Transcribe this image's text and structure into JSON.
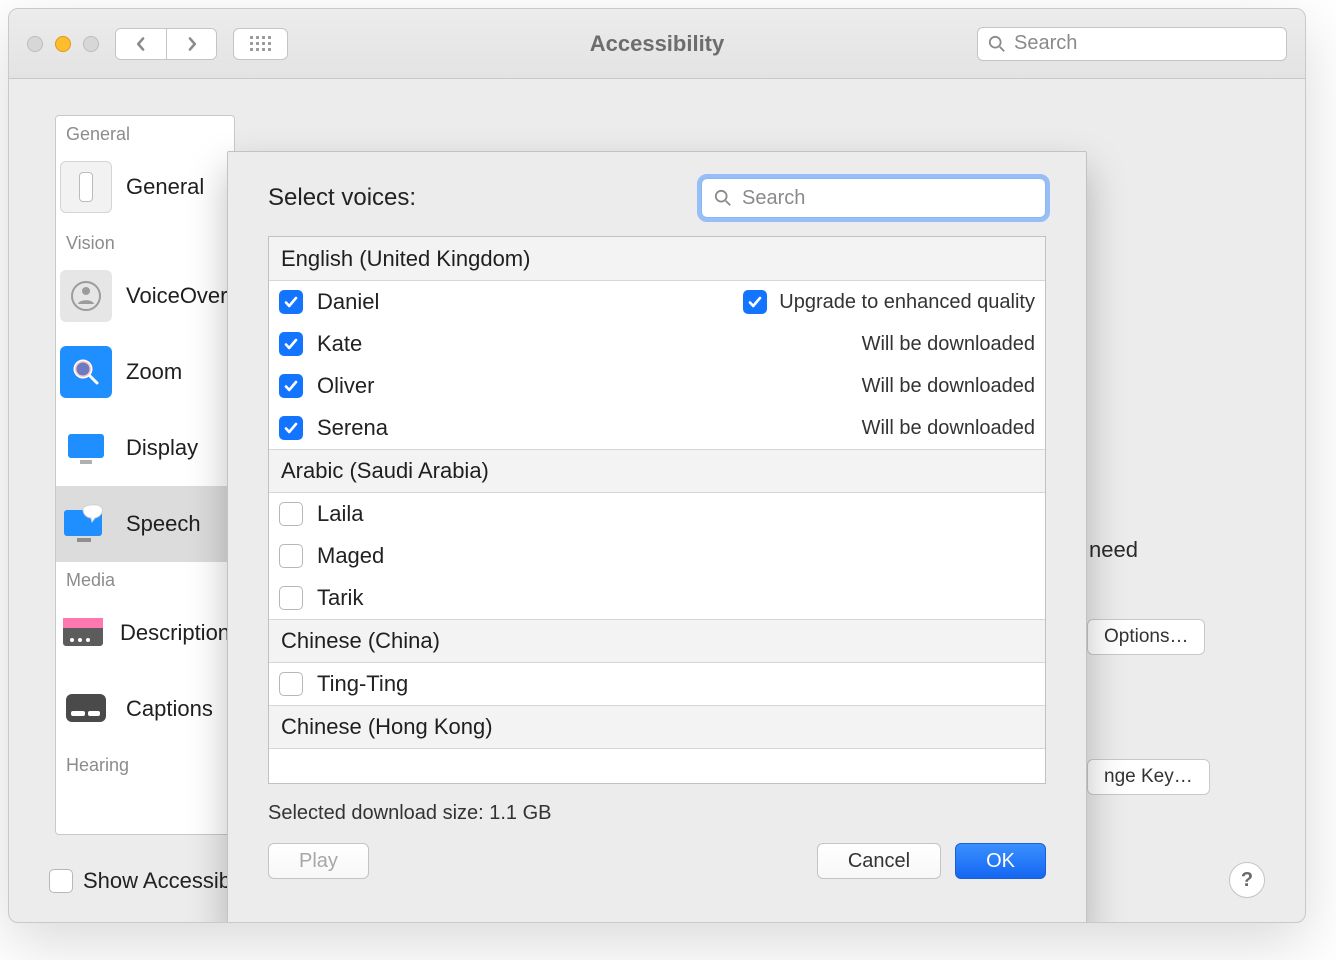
{
  "window": {
    "title": "Accessibility",
    "search_placeholder": "Search"
  },
  "sidebar": {
    "groups": [
      "General",
      "Vision",
      "Media",
      "Hearing"
    ],
    "items": [
      {
        "label": "General"
      },
      {
        "label": "VoiceOver"
      },
      {
        "label": "Zoom"
      },
      {
        "label": "Display"
      },
      {
        "label": "Speech"
      },
      {
        "label": "Descriptions"
      },
      {
        "label": "Captions"
      }
    ]
  },
  "background": {
    "need_text": "need",
    "options_label": "Options…",
    "change_key_label": "nge Key…"
  },
  "footer": {
    "label": "Show Accessibility status in menu bar"
  },
  "dialog": {
    "title": "Select voices:",
    "search_placeholder": "Search",
    "download_line": "Selected download size: 1.1 GB",
    "play_label": "Play",
    "cancel_label": "Cancel",
    "ok_label": "OK",
    "sections": [
      {
        "name": "English (United Kingdom)",
        "voices": [
          {
            "name": "Daniel",
            "checked": true,
            "note": "Upgrade to enhanced quality",
            "note_chk": true
          },
          {
            "name": "Kate",
            "checked": true,
            "note": "Will be downloaded"
          },
          {
            "name": "Oliver",
            "checked": true,
            "note": "Will be downloaded"
          },
          {
            "name": "Serena",
            "checked": true,
            "note": "Will be downloaded"
          }
        ]
      },
      {
        "name": "Arabic (Saudi Arabia)",
        "voices": [
          {
            "name": "Laila",
            "checked": false
          },
          {
            "name": "Maged",
            "checked": false
          },
          {
            "name": "Tarik",
            "checked": false
          }
        ]
      },
      {
        "name": "Chinese (China)",
        "voices": [
          {
            "name": "Ting-Ting",
            "checked": false
          }
        ]
      },
      {
        "name": "Chinese (Hong Kong)",
        "voices": []
      }
    ]
  }
}
